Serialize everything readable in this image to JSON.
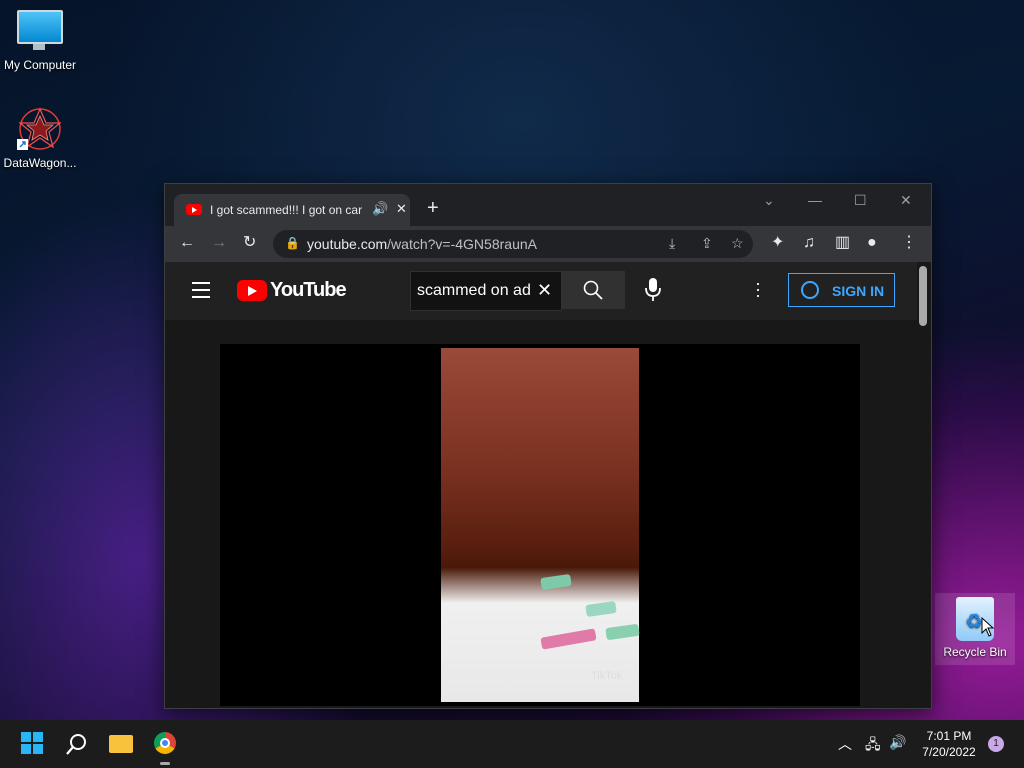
{
  "desktop": {
    "icons": [
      {
        "label": "My Computer"
      },
      {
        "label": "DataWagon..."
      },
      {
        "label": "Recycle Bin"
      }
    ]
  },
  "browser": {
    "tab": {
      "title": "I got scammed!!! I got on car"
    },
    "address": {
      "domain": "youtube.com",
      "path": "/watch?v=-4GN58raunA"
    }
  },
  "youtube": {
    "logo_text": "YouTube",
    "search_query": "scammed on ad",
    "sign_in_label": "SIGN IN",
    "watermark": "TikTok"
  },
  "taskbar": {
    "clock": {
      "time": "7:01 PM",
      "date": "7/20/2022"
    },
    "notification_count": "1"
  }
}
